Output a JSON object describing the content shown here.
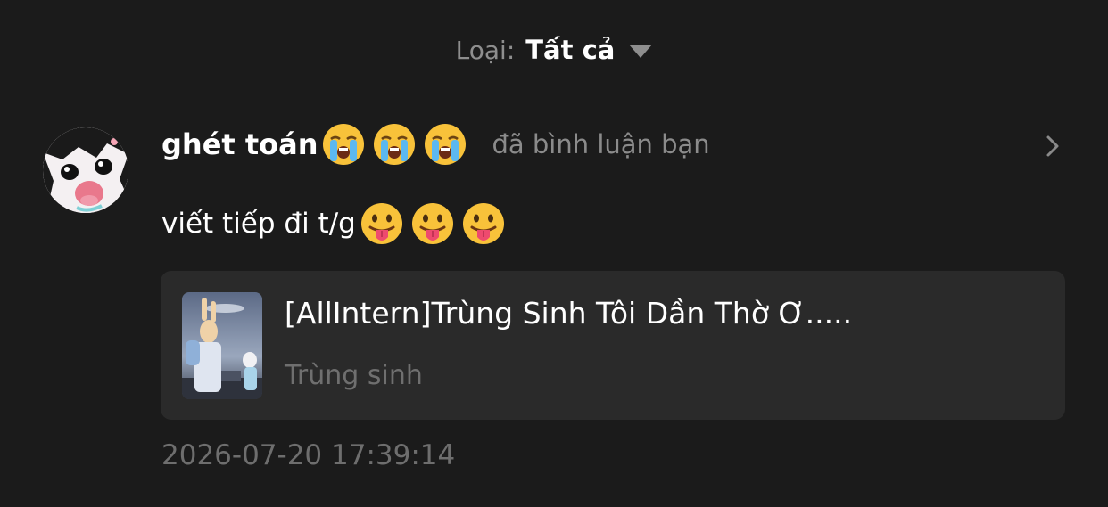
{
  "filter": {
    "label": "Loại:",
    "value": "Tất cả"
  },
  "notification": {
    "username": "ghét toán",
    "username_emojis": [
      "loudly-crying-face",
      "loudly-crying-face",
      "loudly-crying-face"
    ],
    "action": "đã bình luận bạn",
    "comment_text": "viết tiếp đi t/g",
    "comment_emojis": [
      "face-with-tongue",
      "face-with-tongue",
      "face-with-tongue"
    ],
    "book": {
      "title": "[AllIntern]Trùng Sinh Tôi Dần Thờ Ơ.....",
      "genre": "Trùng sinh"
    },
    "timestamp": "2026-07-20 17:39:14"
  },
  "colors": {
    "background": "#1b1b1b",
    "card": "#2a2a2a",
    "primary_text": "#ffffff",
    "secondary_text": "#8b8b8b"
  }
}
